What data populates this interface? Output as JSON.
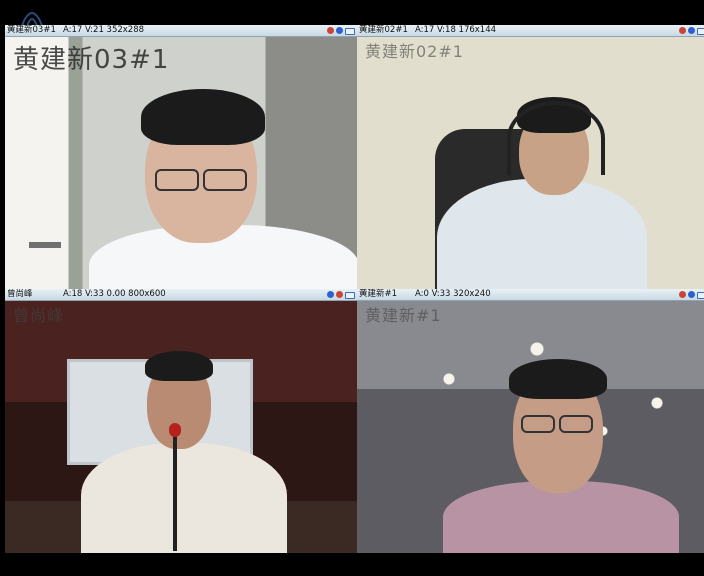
{
  "panels": [
    {
      "title": "黄建新03#1",
      "stats": "A:17 V:21  352x288",
      "caption": "黄建新03#1",
      "selected": false,
      "colors": {
        "bg": "#bfc3bd",
        "wall": "#dfe2dc",
        "shirt": "#f4f6f8",
        "skin": "#d7b29b"
      }
    },
    {
      "title": "黄建新02#1",
      "stats": "A:17 V:18  176x144",
      "caption": "黄建新02#1",
      "selected": false,
      "colors": {
        "bg": "#d8d6c4",
        "wall": "#e3e1cf",
        "shirt": "#dde3e8",
        "skin": "#caa48a"
      }
    },
    {
      "title": "曾尚峰",
      "stats": "A:18 V:33 0.00 800x600",
      "caption": "曾尚峰",
      "selected": false,
      "colors": {
        "bg": "#3a1f1a",
        "wall": "#5b2d25",
        "shirt": "#e9e3d8",
        "skin": "#b88a72"
      }
    },
    {
      "title": "黄建新#1",
      "stats": "A:0 V:33  320x240",
      "caption": "黄建新#1",
      "selected": true,
      "colors": {
        "bg": "#6c6d72",
        "wall": "#9b9aa0",
        "shirt": "#b48f9f",
        "skin": "#c49b84"
      }
    }
  ]
}
